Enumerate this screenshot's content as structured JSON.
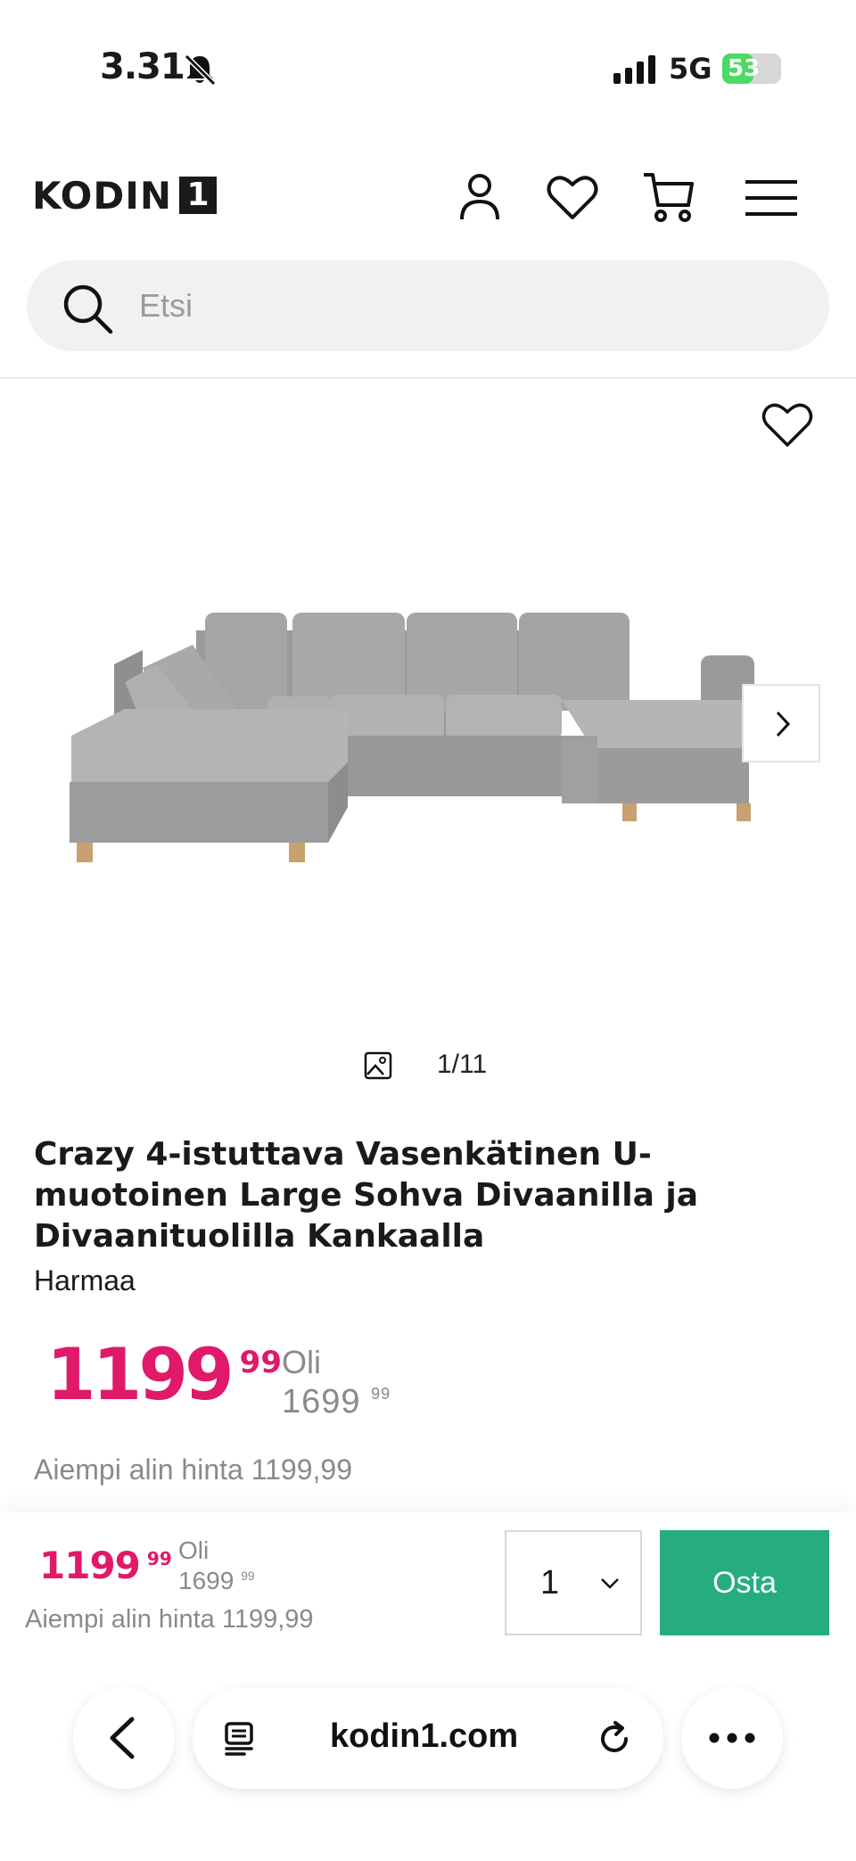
{
  "status_bar": {
    "time": "3.31",
    "network": "5G",
    "battery": "53",
    "battery_level": 0.53
  },
  "header": {
    "logo_text": "KODIN",
    "logo_number": "1"
  },
  "search": {
    "placeholder": "Etsi"
  },
  "gallery": {
    "counter": "1/11"
  },
  "product": {
    "title": "Crazy 4-istuttava Vasenkätinen U-muotoinen Large Sohva Divaanilla ja Divaanituolilla Kankaalla",
    "variant": "Harmaa",
    "price_int": "1199",
    "price_dec": "99",
    "was_label": "Oli",
    "was_int": "1699",
    "was_dec": "99",
    "lowest_price": "Aiempi alin hinta 1199,99"
  },
  "sticky_bar": {
    "price_int": "1199",
    "price_dec": "99",
    "was_label": "Oli",
    "was_int": "1699",
    "was_dec": "99",
    "lowest_price": "Aiempi alin hinta 1199,99",
    "quantity": "1",
    "buy_label": "Osta"
  },
  "browser": {
    "url": "kodin1.com"
  },
  "colors": {
    "accent_price": "#e0196a",
    "buy_button": "#26ad7f",
    "battery": "#4cd964"
  },
  "icons": [
    "bell-slash-icon",
    "signal-icon",
    "user-icon",
    "heart-icon",
    "cart-icon",
    "menu-icon",
    "search-icon",
    "chevron-right-icon",
    "image-icon",
    "chevron-down-icon",
    "back-icon",
    "reader-icon",
    "reload-icon",
    "more-icon"
  ]
}
